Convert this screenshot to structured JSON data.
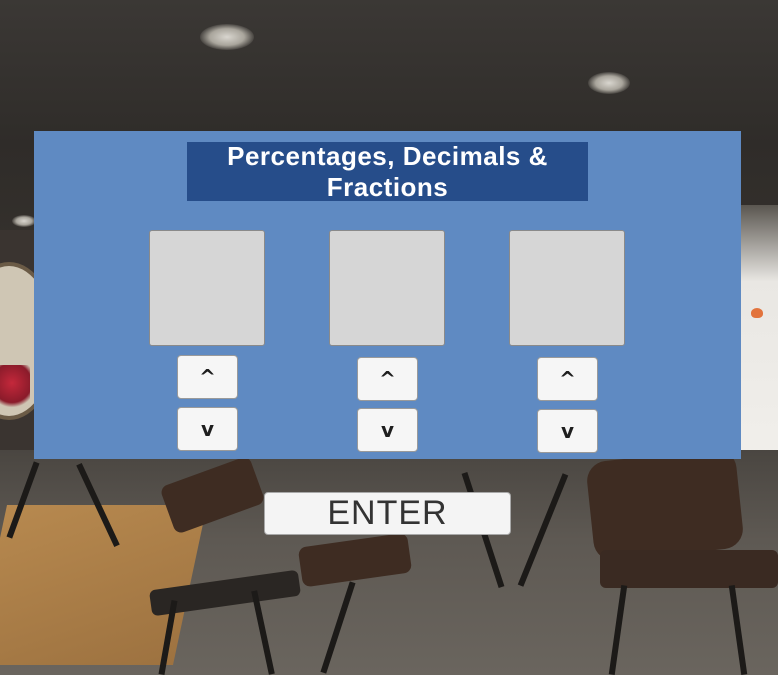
{
  "title": "Percentages, Decimals & Fractions",
  "digits": [
    {
      "value": "",
      "up_label": "^",
      "down_label": "v"
    },
    {
      "value": "",
      "up_label": "^",
      "down_label": "v"
    },
    {
      "value": "",
      "up_label": "^",
      "down_label": "v"
    }
  ],
  "enter_label": "ENTER",
  "colors": {
    "panel": "#5f8ac2",
    "title_bg": "#264d8a",
    "digit_box": "#d6d6d6",
    "button": "#f6f6f6"
  }
}
